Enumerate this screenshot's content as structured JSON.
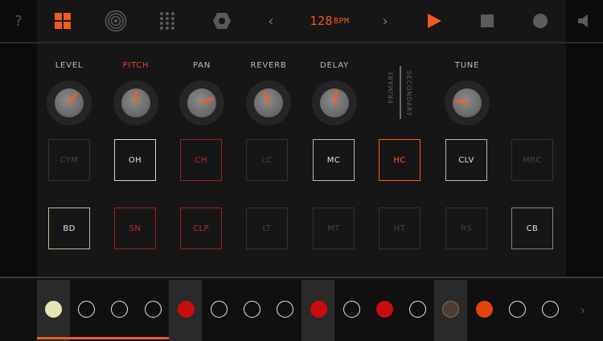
{
  "toolbar": {
    "help_label": "?",
    "tempo_value": "128",
    "tempo_unit": "BPM",
    "prev_label": "‹",
    "next_label": "›"
  },
  "knobs": [
    {
      "label": "LEVEL",
      "accent": false,
      "level": 0.63
    },
    {
      "label": "PITCH",
      "accent": true,
      "level": 0.5
    },
    {
      "label": "PAN",
      "accent": false,
      "level": 0.75
    },
    {
      "label": "REVERB",
      "accent": false,
      "level": 0.42
    },
    {
      "label": "DELAY",
      "accent": false,
      "level": 0.53
    },
    {
      "label": "TUNE",
      "accent": false,
      "level": 0.2
    }
  ],
  "switch": {
    "primary": "PRIMARY",
    "secondary": "SECONDARY"
  },
  "pads_row1": [
    {
      "label": "CYM",
      "state": "off"
    },
    {
      "label": "OH",
      "state": "white"
    },
    {
      "label": "CH",
      "state": "red"
    },
    {
      "label": "LC",
      "state": "off"
    },
    {
      "label": "MC",
      "state": "tan"
    },
    {
      "label": "HC",
      "state": "orange"
    },
    {
      "label": "CLV",
      "state": "tan"
    },
    {
      "label": "MRC",
      "state": "off"
    }
  ],
  "pads_row2": [
    {
      "label": "BD",
      "state": "tan"
    },
    {
      "label": "SN",
      "state": "red"
    },
    {
      "label": "CLP",
      "state": "red"
    },
    {
      "label": "LT",
      "state": "off"
    },
    {
      "label": "MT",
      "state": "off"
    },
    {
      "label": "HT",
      "state": "off"
    },
    {
      "label": "RS",
      "state": "off"
    },
    {
      "label": "CB",
      "state": "brown"
    }
  ],
  "steps": [
    "cream",
    "empty",
    "empty",
    "empty",
    "red",
    "empty",
    "empty",
    "empty",
    "red",
    "empty",
    "red",
    "empty",
    "brown",
    "orange",
    "empty",
    "empty"
  ],
  "seq_next_label": "›",
  "colors": {
    "accent": "#f05a1e",
    "red": "#c90d0d"
  }
}
